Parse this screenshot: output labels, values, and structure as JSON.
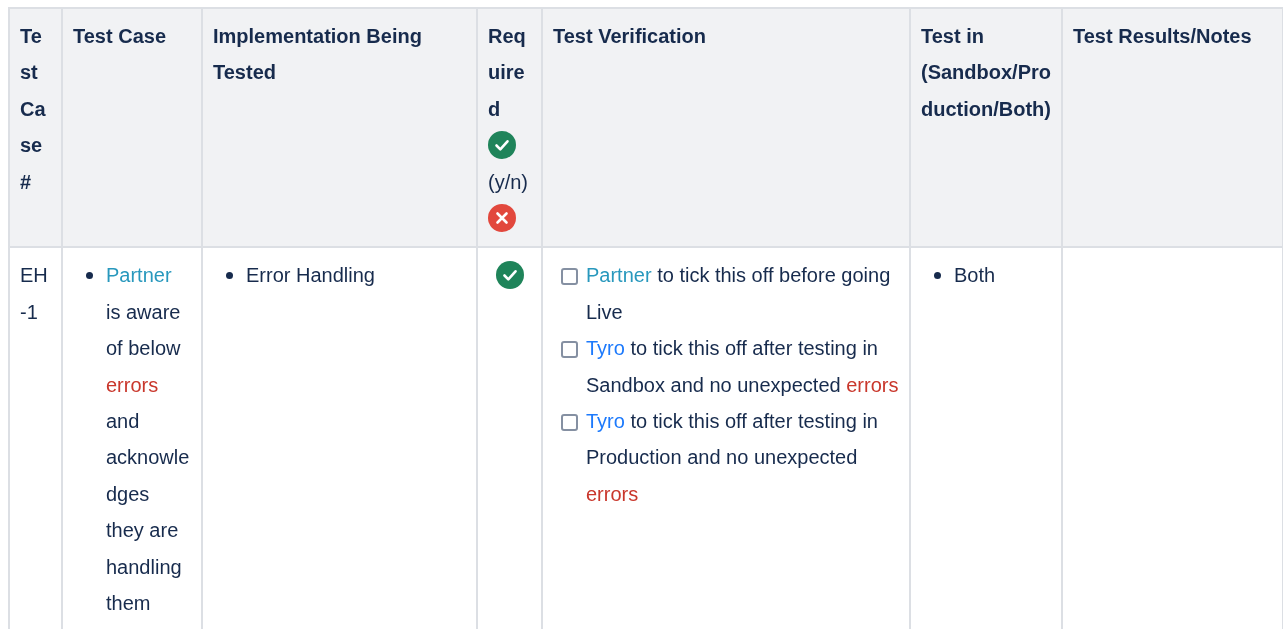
{
  "table": {
    "columns": [
      {
        "label": "Test Case #"
      },
      {
        "label": "Test Case"
      },
      {
        "label": "Implementation Being Tested"
      },
      {
        "label": "Required",
        "note": "(y/n)"
      },
      {
        "label": "Test Verification"
      },
      {
        "label": "Test in (Sandbox/Production/Both)"
      },
      {
        "label": "Test Results/Notes"
      }
    ],
    "rows": [
      {
        "test_case_id": "EH-1",
        "test_case": [
          {
            "segments": [
              {
                "text": "Partner",
                "color": "#2898bd"
              },
              {
                "text": " is aware of below "
              },
              {
                "text": "errors",
                "color": "#c9372c"
              },
              {
                "text": " and acknowledges they are handling them"
              }
            ]
          }
        ],
        "implementation": [
          {
            "segments": [
              {
                "text": "Error Handling"
              }
            ]
          }
        ],
        "required": true,
        "verification": [
          {
            "checked": false,
            "segments": [
              {
                "text": "Partner",
                "color": "#2898bd"
              },
              {
                "text": " to tick this off before going Live"
              }
            ]
          },
          {
            "checked": false,
            "segments": [
              {
                "text": "Tyro",
                "color": "#1d7afc"
              },
              {
                "text": " to tick this off after testing in Sandbox and no unexpected "
              },
              {
                "text": "errors",
                "color": "#c9372c"
              }
            ]
          },
          {
            "checked": false,
            "segments": [
              {
                "text": "Tyro",
                "color": "#1d7afc"
              },
              {
                "text": " to tick this off after testing in Production and no unexpected "
              },
              {
                "text": "errors",
                "color": "#c9372c"
              }
            ]
          }
        ],
        "environment": [
          {
            "segments": [
              {
                "text": "Both"
              }
            ]
          }
        ]
      }
    ]
  }
}
